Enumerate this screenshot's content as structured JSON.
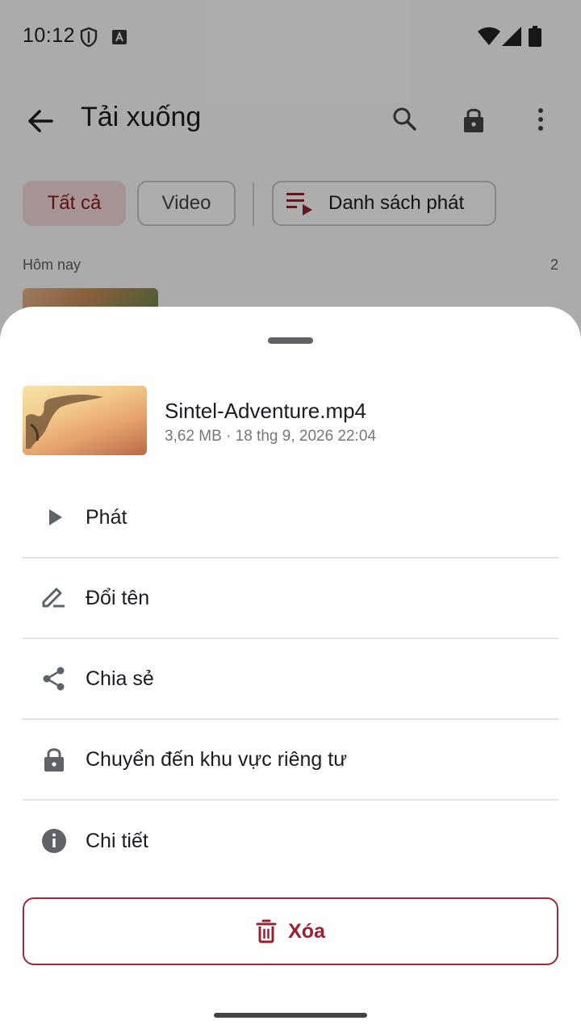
{
  "status_bar": {
    "time": "10:12",
    "icons": [
      "shield-icon",
      "text-a-icon",
      "wifi-icon",
      "cellular-icon",
      "battery-icon"
    ]
  },
  "header": {
    "title": "Tải xuống",
    "icons": [
      "back-arrow-icon",
      "search-icon",
      "lock-icon",
      "more-vert-icon"
    ]
  },
  "filters": {
    "all": "Tất cả",
    "video": "Video",
    "playlist": "Danh sách phát"
  },
  "section": {
    "label": "Hôm nay",
    "count": "2"
  },
  "sheet": {
    "file_name": "Sintel-Adventure.mp4",
    "file_meta": "3,62 MB · 18 thg 9, 2026 22:04",
    "actions": [
      {
        "label": "Phát",
        "icon": "play-icon"
      },
      {
        "label": "Đổi tên",
        "icon": "edit-icon"
      },
      {
        "label": "Chia sẻ",
        "icon": "share-icon"
      },
      {
        "label": "Chuyển đến khu vực riêng tư",
        "icon": "lock-icon"
      },
      {
        "label": "Chi tiết",
        "icon": "info-icon"
      }
    ],
    "delete_label": "Xóa"
  },
  "colors": {
    "accent": "#9a2030",
    "chip_selected_bg": "#f6dbda",
    "icon_gray": "#5f6368"
  }
}
